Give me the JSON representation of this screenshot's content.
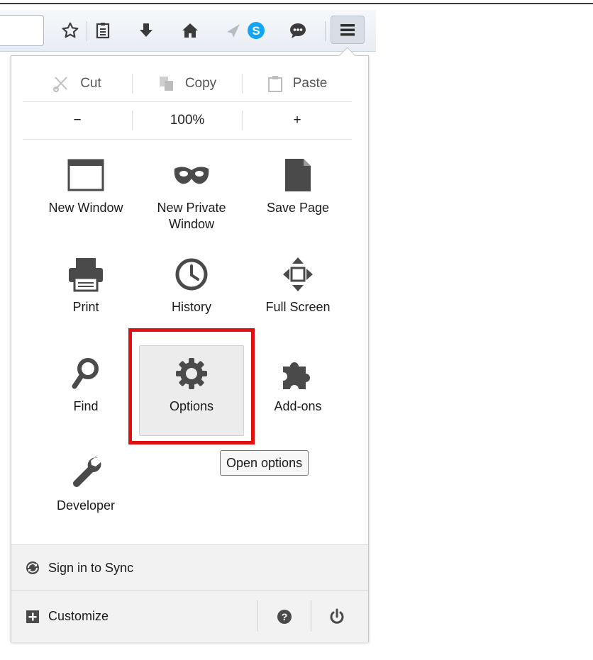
{
  "edit": {
    "cut": "Cut",
    "copy": "Copy",
    "paste": "Paste"
  },
  "zoom": {
    "minus": "−",
    "level": "100%",
    "plus": "+"
  },
  "items": [
    {
      "label": "New Window",
      "icon": "window-icon"
    },
    {
      "label": "New Private\nWindow",
      "icon": "mask-icon"
    },
    {
      "label": "Save Page",
      "icon": "page-icon"
    },
    {
      "label": "Print",
      "icon": "printer-icon"
    },
    {
      "label": "History",
      "icon": "clock-icon"
    },
    {
      "label": "Full Screen",
      "icon": "fullscreen-icon"
    },
    {
      "label": "Find",
      "icon": "magnifier-icon"
    },
    {
      "label": "Options",
      "icon": "gear-icon"
    },
    {
      "label": "Add-ons",
      "icon": "puzzle-icon"
    },
    {
      "label": "Developer",
      "icon": "wrench-icon"
    }
  ],
  "tooltip": "Open options",
  "footer": {
    "sync": "Sign in to Sync",
    "customize": "Customize"
  },
  "colors": {
    "highlight_border": "#e01010",
    "skype": "#12a5f4"
  }
}
